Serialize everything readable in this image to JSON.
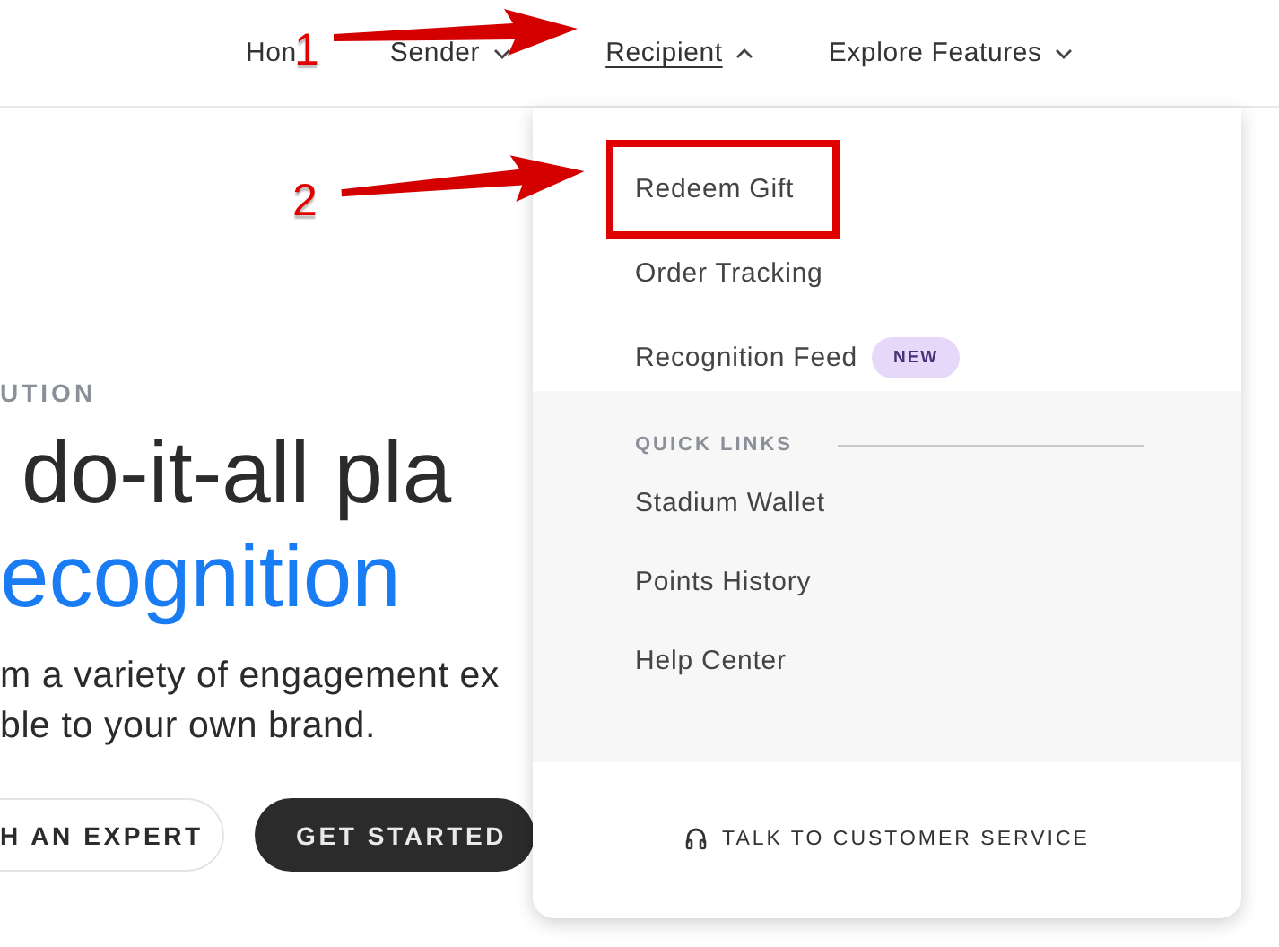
{
  "nav": {
    "items": [
      {
        "label": "Hon",
        "kind": "link",
        "selected": false
      },
      {
        "label": "Sender",
        "kind": "menu",
        "selected": false,
        "expanded": false
      },
      {
        "label": "Recipient",
        "kind": "menu",
        "selected": true,
        "expanded": true
      },
      {
        "label": "Explore Features",
        "kind": "menu",
        "selected": false,
        "expanded": false
      }
    ]
  },
  "hero": {
    "eyebrow": "UTION",
    "heading_lines": [
      "do-it-all pla",
      "ecognition"
    ],
    "paragraph_lines": [
      "m a variety of engagement ex",
      "ble to your own brand."
    ],
    "buttons": [
      {
        "label": "H AN EXPERT",
        "kind": "outline"
      },
      {
        "label": "GET STARTED",
        "kind": "filled"
      }
    ]
  },
  "dropdown": {
    "items": [
      {
        "label": "Redeem Gift"
      },
      {
        "label": "Order Tracking"
      },
      {
        "label": "Recognition Feed",
        "badge": "NEW"
      }
    ],
    "quick_links": {
      "heading": "QUICK LINKS",
      "items": [
        "Stadium Wallet",
        "Points History",
        "Help Center"
      ]
    },
    "footer": {
      "label": "TALK TO CUSTOMER SERVICE"
    }
  },
  "annotations": [
    {
      "kind": "arrow",
      "label": "1"
    },
    {
      "kind": "arrow",
      "label": "2"
    },
    {
      "kind": "box"
    }
  ]
}
